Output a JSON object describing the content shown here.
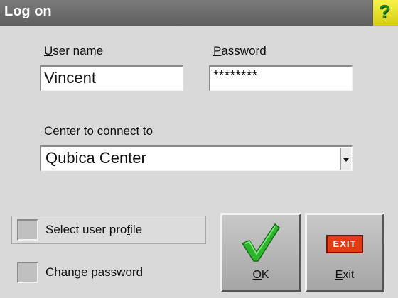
{
  "window": {
    "title": "Log on",
    "help_glyph": "?"
  },
  "labels": {
    "username_prefix": "U",
    "username_rest": "ser name",
    "password_prefix": "P",
    "password_rest": "assword",
    "center_prefix": "C",
    "center_rest": "enter to connect to"
  },
  "inputs": {
    "username_value": "Vincent",
    "password_value": "********",
    "center_value": "Qubica Center"
  },
  "options": {
    "select_profile_pre": "Select user pro",
    "select_profile_u": "f",
    "select_profile_post": "ile",
    "change_pwd_u": "C",
    "change_pwd_rest": "hange password"
  },
  "buttons": {
    "ok_u": "O",
    "ok_rest": "K",
    "exit_sign": "EXIT",
    "exit_u": "E",
    "exit_rest": "xit"
  },
  "colors": {
    "check": "#2db62d",
    "exit_sign": "#e53b12"
  }
}
